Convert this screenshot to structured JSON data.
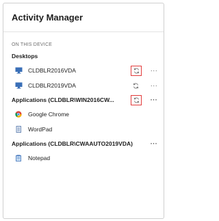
{
  "header": {
    "title": "Activity Manager"
  },
  "section": {
    "label": "ON THIS DEVICE"
  },
  "desktops": {
    "title": "Desktops",
    "items": [
      {
        "label": "CLDBLR2016VDA",
        "icon": "desktop-icon"
      },
      {
        "label": "CLDBLR2019VDA",
        "icon": "desktop-icon"
      }
    ]
  },
  "apps1": {
    "title": "Applications (CLDBLR\\WIN2016CW...",
    "items": [
      {
        "label": "Google Chrome",
        "icon": "chrome-icon"
      },
      {
        "label": "WordPad",
        "icon": "wordpad-icon"
      }
    ]
  },
  "apps2": {
    "title": "Applications (CLDBLR\\CWAAUTO2019VDA)",
    "items": [
      {
        "label": "Notepad",
        "icon": "notepad-icon"
      }
    ]
  },
  "more_glyph": "···",
  "colors": {
    "highlight": "#e23b3b",
    "desktop_icon": "#3a6fb7"
  }
}
